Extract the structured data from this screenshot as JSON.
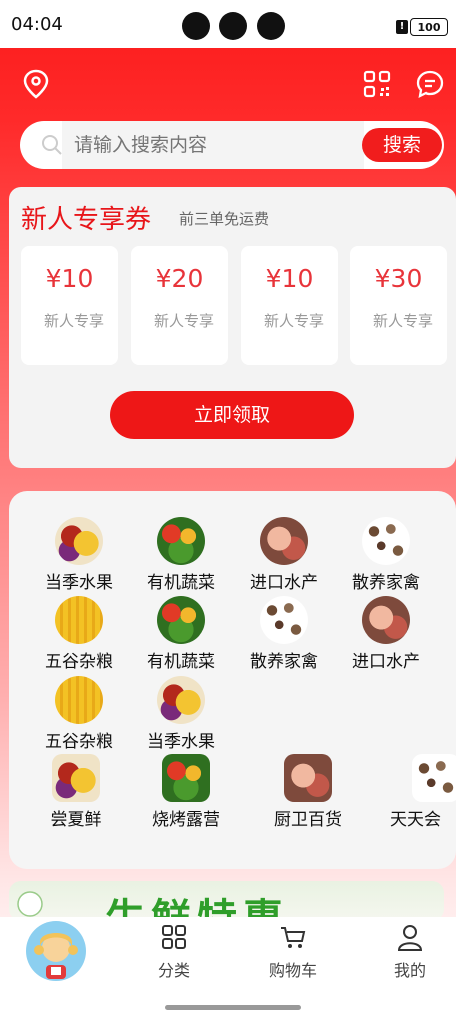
{
  "status_bar": {
    "time": "04:04",
    "battery": "100",
    "alert": "!"
  },
  "header": {
    "location_icon": "location-pin-icon",
    "qr_icon": "qr-code-icon",
    "message_icon": "message-icon"
  },
  "search": {
    "placeholder": "请输入搜索内容",
    "button": "搜索"
  },
  "coupons": {
    "title": "新人专享券",
    "subtitle": "前三单免运费",
    "items": [
      {
        "amount": "¥10",
        "label": "新人专享"
      },
      {
        "amount": "¥20",
        "label": "新人专享"
      },
      {
        "amount": "¥10",
        "label": "新人专享"
      },
      {
        "amount": "¥30",
        "label": "新人专享"
      }
    ],
    "claim_button": "立即领取"
  },
  "categories": {
    "rows": [
      [
        {
          "name": "当季水果",
          "img": "fruit"
        },
        {
          "name": "有机蔬菜",
          "img": "veg"
        },
        {
          "name": "进口水产",
          "img": "seafood"
        },
        {
          "name": "散养家禽",
          "img": "poultry"
        }
      ],
      [
        {
          "name": "五谷杂粮",
          "img": "corn"
        },
        {
          "name": "有机蔬菜",
          "img": "veg"
        },
        {
          "name": "散养家禽",
          "img": "poultry"
        },
        {
          "name": "进口水产",
          "img": "seafood"
        }
      ],
      [
        {
          "name": "五谷杂粮",
          "img": "corn"
        },
        {
          "name": "当季水果",
          "img": "fruit"
        }
      ],
      [
        {
          "name": "尝夏鲜",
          "img": "fruit"
        },
        {
          "name": "烧烤露营",
          "img": "veg"
        },
        {
          "name": "厨卫百货",
          "img": "seafood"
        },
        {
          "name": "天天会",
          "img": "poultry"
        }
      ]
    ]
  },
  "banner": {
    "text": "生鲜特惠"
  },
  "tabbar": {
    "tabs": [
      {
        "label": "",
        "icon": "avatar-icon"
      },
      {
        "label": "分类",
        "icon": "category-grid-icon"
      },
      {
        "label": "购物车",
        "icon": "cart-icon"
      },
      {
        "label": "我的",
        "icon": "profile-icon"
      }
    ]
  },
  "colors": {
    "primary": "#f11d1d",
    "coupon_amount": "#e8343a"
  }
}
